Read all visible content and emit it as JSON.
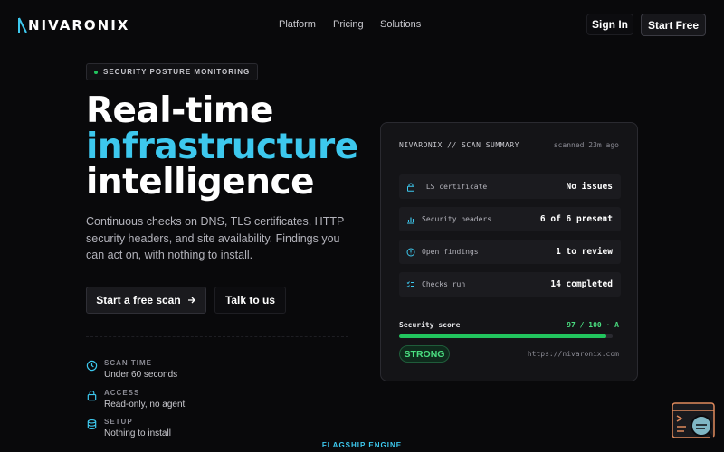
{
  "brand": {
    "name": "NIVARONIX",
    "accent": "#3dc8ee"
  },
  "nav": {
    "items": [
      "Platform",
      "Pricing",
      "Solutions"
    ],
    "sign_in": "Sign In",
    "start_free": "Start Free"
  },
  "hero": {
    "badge": "SECURITY POSTURE MONITORING",
    "title_line1": "Real-time",
    "title_line2": "infrastructure",
    "title_line3": "intelligence",
    "description": "Continuous checks on DNS, TLS certificates, HTTP security headers, and site availability. Findings you can act on, with nothing to install.",
    "cta_primary": "Start a free scan",
    "cta_secondary": "Talk to us"
  },
  "features": [
    {
      "label": "SCAN TIME",
      "value": "Under 60 seconds",
      "icon": "clock-icon"
    },
    {
      "label": "ACCESS",
      "value": "Read-only, no agent",
      "icon": "lock-icon"
    },
    {
      "label": "SETUP",
      "value": "Nothing to install",
      "icon": "database-icon"
    }
  ],
  "card": {
    "title": "NIVARONIX // SCAN SUMMARY",
    "time": "scanned 23m ago",
    "rows": [
      {
        "label": "TLS certificate",
        "value": "No issues",
        "icon": "lock-icon"
      },
      {
        "label": "Security headers",
        "value": "6 of 6 present",
        "icon": "bar-chart-icon"
      },
      {
        "label": "Open findings",
        "value": "1 to review",
        "icon": "alert-circle-icon"
      },
      {
        "label": "Checks run",
        "value": "14 completed",
        "icon": "checklist-icon"
      }
    ],
    "score_label": "Security score",
    "score_value": "97 / 100 · A",
    "score_fraction": 0.97,
    "status": "STRONG",
    "url": "https://nivaronix.com"
  },
  "footer_label": "FLAGSHIP ENGINE"
}
